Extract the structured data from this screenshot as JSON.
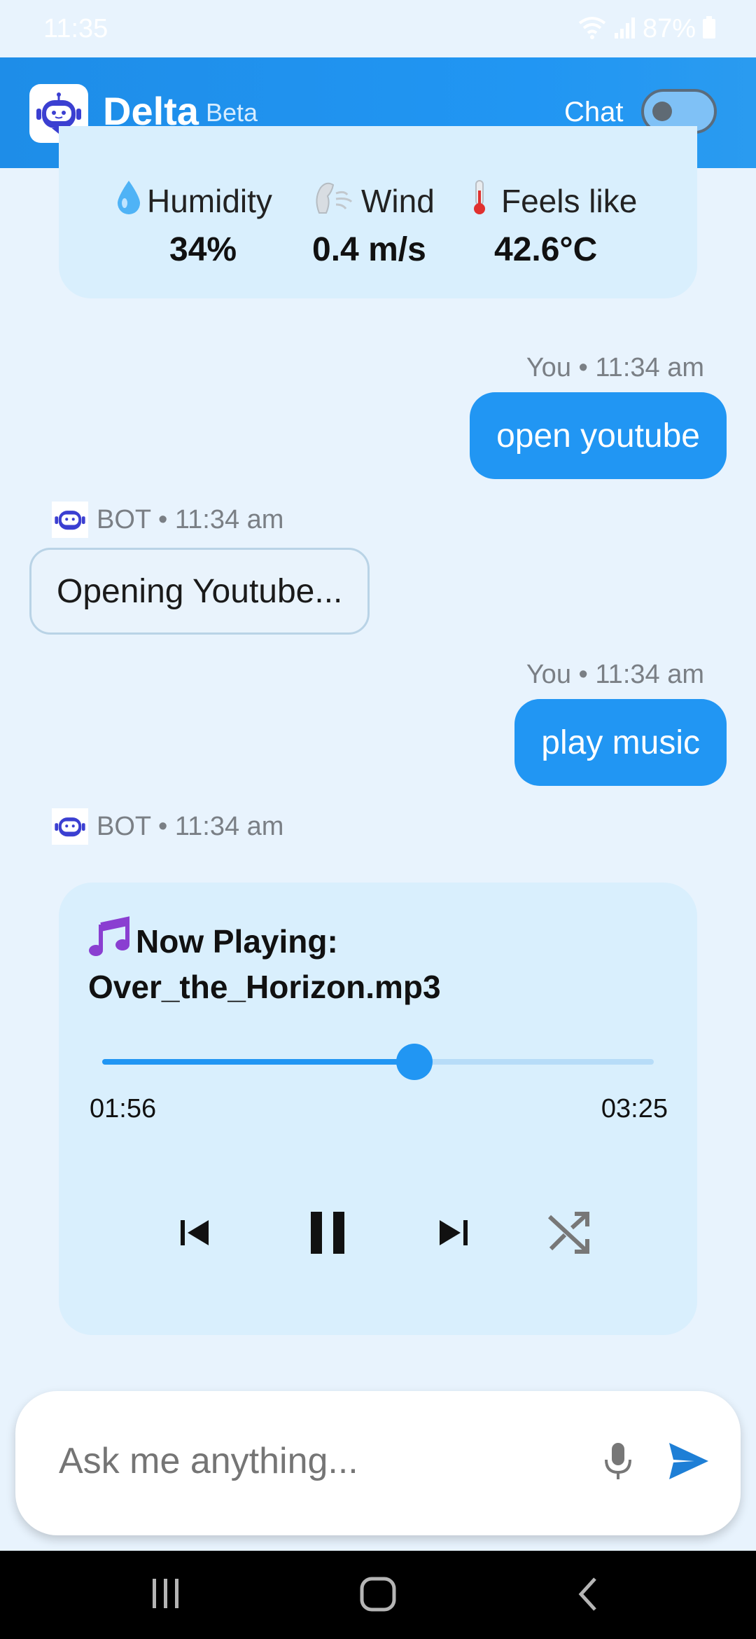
{
  "status": {
    "time": "11:35",
    "battery": "87%"
  },
  "header": {
    "app_name": "Delta",
    "badge": "Beta",
    "chat_label": "Chat",
    "chat_toggle_on": false
  },
  "weather": {
    "humidity": {
      "label": "Humidity",
      "value": "34%"
    },
    "wind": {
      "label": "Wind",
      "value": "0.4 m/s"
    },
    "feels_like": {
      "label": "Feels like",
      "value": "42.6°C"
    }
  },
  "messages": [
    {
      "sender": "You",
      "time": "11:34 am",
      "meta": "You • 11:34 am",
      "text": "open youtube"
    },
    {
      "sender": "BOT",
      "time": "11:34 am",
      "meta": "BOT • 11:34 am",
      "text": "Opening Youtube..."
    },
    {
      "sender": "You",
      "time": "11:34 am",
      "meta": "You • 11:34 am",
      "text": "play music"
    },
    {
      "sender": "BOT",
      "time": "11:34 am",
      "meta": "BOT • 11:34 am",
      "text": ""
    }
  ],
  "player": {
    "heading": "Now Playing:",
    "track": "Over_the_Horizon.mp3",
    "current_time": "01:56",
    "total_time": "03:25",
    "progress": 0.566,
    "controls": [
      "previous-icon",
      "pause-icon",
      "next-icon",
      "shuffle-icon"
    ]
  },
  "input": {
    "placeholder": "Ask me anything..."
  },
  "colors": {
    "accent": "#2196f3",
    "card": "#d9effd",
    "background": "#e8f3fd"
  }
}
